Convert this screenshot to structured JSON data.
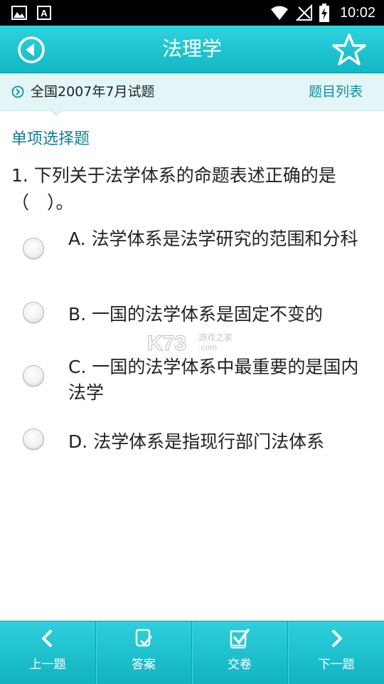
{
  "status_bar": {
    "time": "10:02"
  },
  "header": {
    "title": "法理学"
  },
  "subbar": {
    "exam_title": "全国2007年7月试题",
    "list_link": "题目列表"
  },
  "question": {
    "type": "单项选择题",
    "text": "1. 下列关于法学体系的命题表述正确的是（　）。",
    "options": [
      {
        "label": "A. 法学体系是法学研究的范围和分科"
      },
      {
        "label": "B. 一国的法学体系是固定不变的"
      },
      {
        "label": "C. 一国的法学体系中最重要的是国内法学"
      },
      {
        "label": "D. 法学体系是指现行部门法体系"
      }
    ]
  },
  "watermark": {
    "text": "K73",
    "sub": "游戏之家",
    "domain": ".com"
  },
  "bottom_nav": {
    "prev": "上一题",
    "answer": "答案",
    "submit": "交卷",
    "next": "下一题"
  },
  "colors": {
    "accent": "#1cc3cf",
    "link": "#148ea0",
    "qtype": "#0e7f93"
  }
}
